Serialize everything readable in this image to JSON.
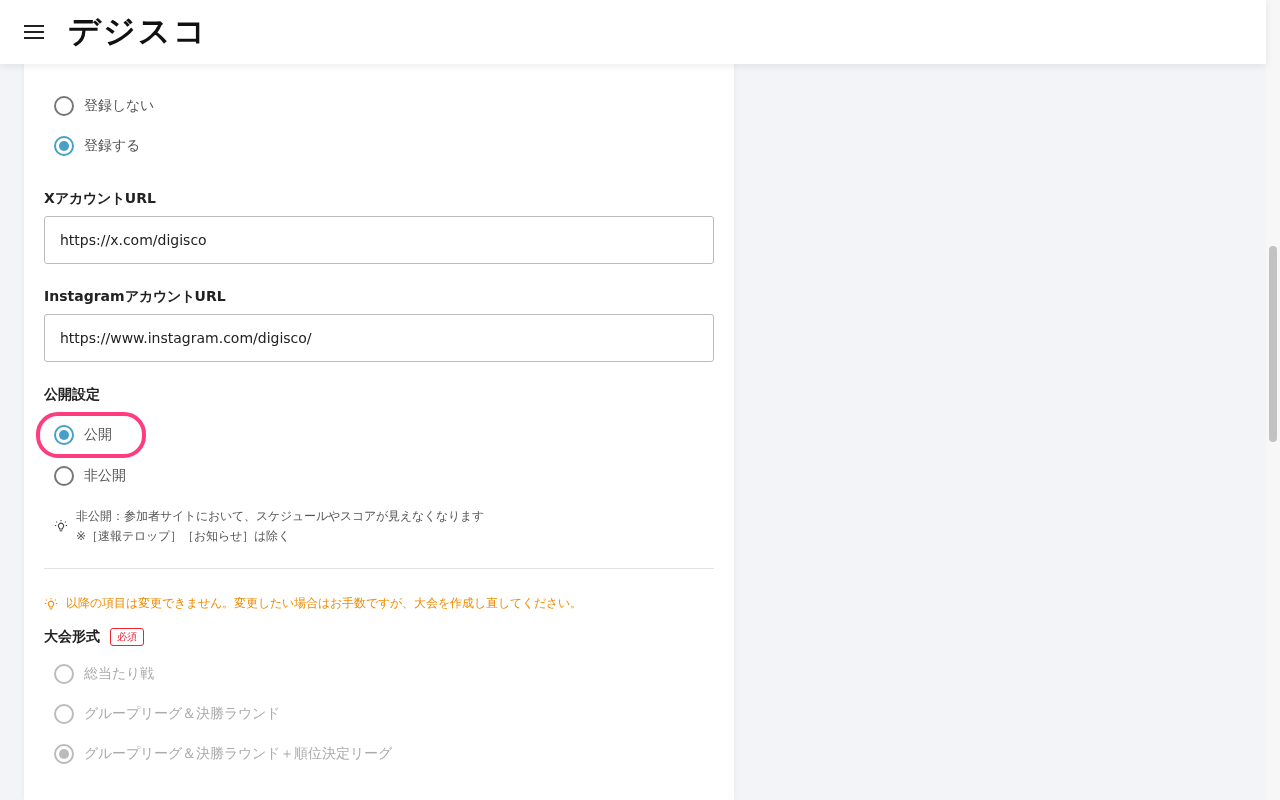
{
  "header": {
    "logo": "デジスコ"
  },
  "sections": [
    {
      "kind": "radio",
      "options": [
        {
          "label": "登録しない",
          "selected": false,
          "disabled": false,
          "highlighted": false
        },
        {
          "label": "登録する",
          "selected": true,
          "disabled": false,
          "highlighted": false
        }
      ]
    },
    {
      "kind": "input",
      "label": "XアカウントURL",
      "value": "https://x.com/digisco"
    },
    {
      "kind": "input",
      "label": "InstagramアカウントURL",
      "value": "https://www.instagram.com/digisco/"
    },
    {
      "kind": "radio",
      "label": "公開設定",
      "options": [
        {
          "label": "公開",
          "selected": true,
          "disabled": false,
          "highlighted": true
        },
        {
          "label": "非公開",
          "selected": false,
          "disabled": false,
          "highlighted": false
        }
      ],
      "note": [
        "非公開：参加者サイトにおいて、スケジュールやスコアが見えなくなります",
        "※［速報テロップ］［お知らせ］は除く"
      ]
    },
    {
      "kind": "divider"
    },
    {
      "kind": "warning",
      "text": "以降の項目は変更できません。変更したい場合はお手数ですが、大会を作成し直してください。"
    },
    {
      "kind": "radio",
      "label": "大会形式",
      "required": "必須",
      "options": [
        {
          "label": "総当たり戦",
          "selected": false,
          "disabled": true,
          "highlighted": false
        },
        {
          "label": "グループリーグ＆決勝ラウンド",
          "selected": false,
          "disabled": true,
          "highlighted": false
        },
        {
          "label": "グループリーグ＆決勝ラウンド＋順位決定リーグ",
          "selected": true,
          "disabled": true,
          "highlighted": false
        }
      ]
    }
  ]
}
